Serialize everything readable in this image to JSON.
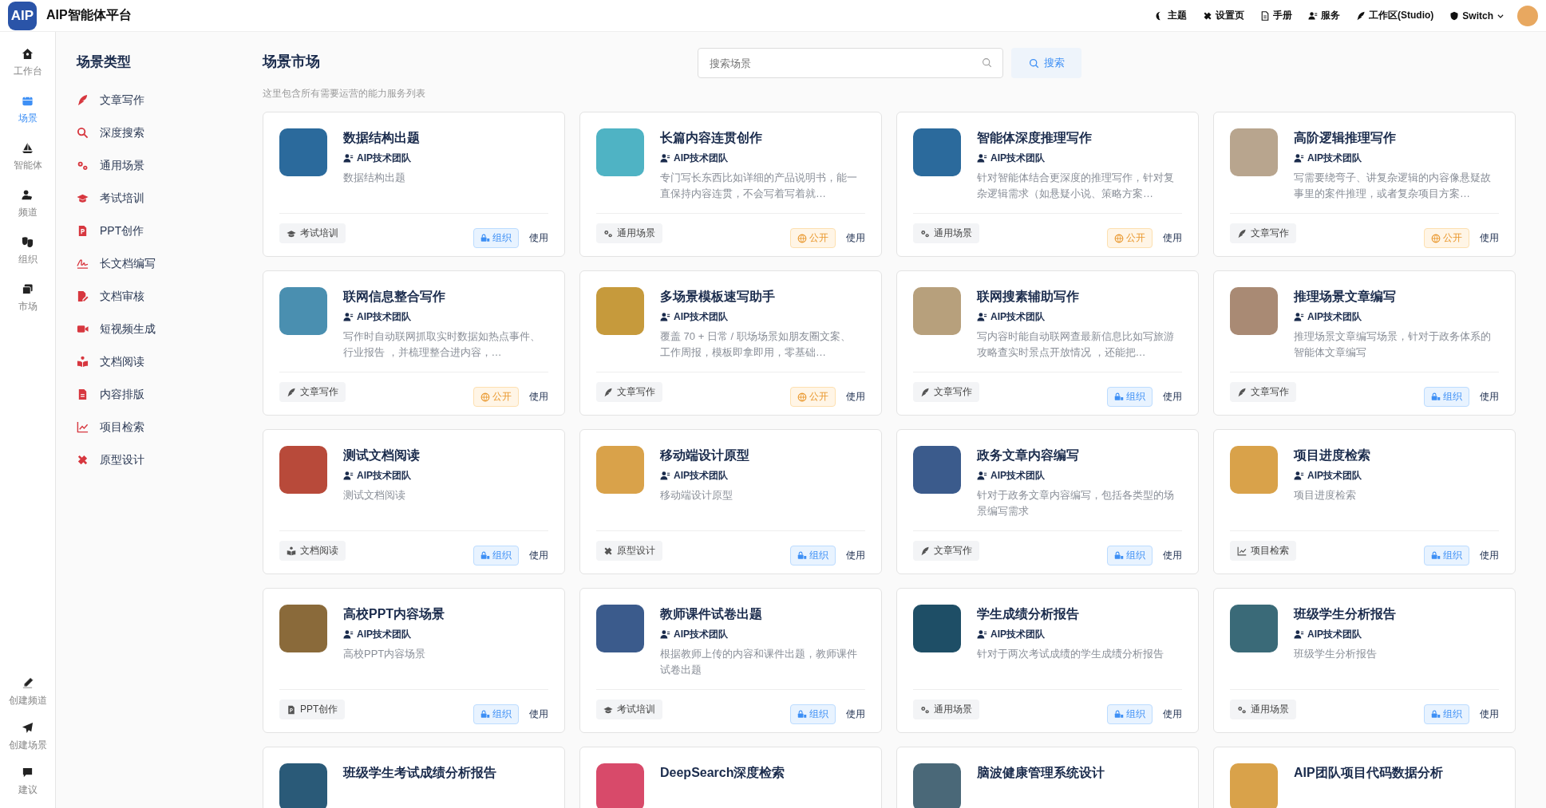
{
  "app": {
    "logo": "AIP",
    "title": "AIP智能体平台"
  },
  "top_nav": [
    {
      "kind": "theme",
      "label": "主题"
    },
    {
      "kind": "settings",
      "label": "设置页"
    },
    {
      "kind": "manual",
      "label": "手册"
    },
    {
      "kind": "service",
      "label": "服务"
    },
    {
      "kind": "studio",
      "label": "工作区(Studio)"
    },
    {
      "kind": "switch",
      "label": "Switch"
    }
  ],
  "rail": {
    "items": [
      {
        "kind": "home",
        "label": "工作台",
        "selected": false
      },
      {
        "kind": "scene",
        "label": "场景",
        "selected": true
      },
      {
        "kind": "agent",
        "label": "智能体",
        "selected": false
      },
      {
        "kind": "channel",
        "label": "频道",
        "selected": false
      },
      {
        "kind": "org",
        "label": "组织",
        "selected": false
      },
      {
        "kind": "market",
        "label": "市场",
        "selected": false
      }
    ],
    "bottom": [
      {
        "kind": "create-channel",
        "label": "创建频道"
      },
      {
        "kind": "create-scene",
        "label": "创建场景"
      },
      {
        "kind": "feedback",
        "label": "建议"
      }
    ]
  },
  "categories": {
    "title": "场景类型",
    "items": [
      {
        "kind": "writing",
        "label": "文章写作",
        "selected": false
      },
      {
        "kind": "search",
        "label": "深度搜索",
        "selected": false
      },
      {
        "kind": "general",
        "label": "通用场景",
        "selected": false
      },
      {
        "kind": "exam",
        "label": "考试培训",
        "selected": false
      },
      {
        "kind": "ppt",
        "label": "PPT创作",
        "selected": false
      },
      {
        "kind": "longdoc",
        "label": "长文档编写",
        "selected": false
      },
      {
        "kind": "review",
        "label": "文档审核",
        "selected": false
      },
      {
        "kind": "video",
        "label": "短视频生成",
        "selected": false
      },
      {
        "kind": "reading",
        "label": "文档阅读",
        "selected": false
      },
      {
        "kind": "layout",
        "label": "内容排版",
        "selected": false
      },
      {
        "kind": "chart",
        "label": "项目检索",
        "selected": false
      },
      {
        "kind": "design",
        "label": "原型设计",
        "selected": false
      }
    ]
  },
  "market": {
    "title": "场景市场",
    "subtitle": "这里包含所有需要运营的能力服务列表",
    "search": {
      "placeholder": "搜索场景",
      "button": "搜索"
    },
    "cards": [
      {
        "title": "数据结构出题",
        "team": "AIP技术团队",
        "description": "数据结构出题",
        "tag": {
          "kind": "exam",
          "label": "考试培训"
        },
        "visibility": {
          "kind": "org",
          "label": "组织"
        },
        "action": "使用"
      },
      {
        "title": "长篇内容连贯创作",
        "team": "AIP技术团队",
        "description": "专门写长东西比如详细的产品说明书，能一直保持内容连贯，不会写着写着就…",
        "tag": {
          "kind": "general",
          "label": "通用场景"
        },
        "visibility": {
          "kind": "public",
          "label": "公开"
        },
        "action": "使用"
      },
      {
        "title": "智能体深度推理写作",
        "team": "AIP技术团队",
        "description": "针对智能体结合更深度的推理写作，针对复杂逻辑需求（如悬疑小说、策略方案…",
        "tag": {
          "kind": "general",
          "label": "通用场景"
        },
        "visibility": {
          "kind": "public",
          "label": "公开"
        },
        "action": "使用"
      },
      {
        "title": "高阶逻辑推理写作",
        "team": "AIP技术团队",
        "description": "写需要绕弯子、讲复杂逻辑的内容像悬疑故事里的案件推理，或者复杂项目方案…",
        "tag": {
          "kind": "writing",
          "label": "文章写作"
        },
        "visibility": {
          "kind": "public",
          "label": "公开"
        },
        "action": "使用"
      },
      {
        "title": "联网信息整合写作",
        "team": "AIP技术团队",
        "description": "写作时自动联网抓取实时数据如热点事件、行业报告 ，并梳理整合进内容，…",
        "tag": {
          "kind": "writing",
          "label": "文章写作"
        },
        "visibility": {
          "kind": "public",
          "label": "公开"
        },
        "action": "使用"
      },
      {
        "title": "多场景模板速写助手",
        "team": "AIP技术团队",
        "description": "覆盖 70 + 日常 / 职场场景如朋友圈文案、工作周报，模板即拿即用，零基础…",
        "tag": {
          "kind": "writing",
          "label": "文章写作"
        },
        "visibility": {
          "kind": "public",
          "label": "公开"
        },
        "action": "使用"
      },
      {
        "title": "联网搜素辅助写作",
        "team": "AIP技术团队",
        "description": "写内容时能自动联网查最新信息比如写旅游攻略查实时景点开放情况 ，还能把…",
        "tag": {
          "kind": "writing",
          "label": "文章写作"
        },
        "visibility": {
          "kind": "org",
          "label": "组织"
        },
        "action": "使用"
      },
      {
        "title": "推理场景文章编写",
        "team": "AIP技术团队",
        "description": "推理场景文章编写场景，针对于政务体系的智能体文章编写",
        "tag": {
          "kind": "writing",
          "label": "文章写作"
        },
        "visibility": {
          "kind": "org",
          "label": "组织"
        },
        "action": "使用"
      },
      {
        "title": "测试文档阅读",
        "team": "AIP技术团队",
        "description": "测试文档阅读",
        "tag": {
          "kind": "reading",
          "label": "文档阅读"
        },
        "visibility": {
          "kind": "org",
          "label": "组织"
        },
        "action": "使用"
      },
      {
        "title": "移动端设计原型",
        "team": "AIP技术团队",
        "description": "移动端设计原型",
        "tag": {
          "kind": "design",
          "label": "原型设计"
        },
        "visibility": {
          "kind": "org",
          "label": "组织"
        },
        "action": "使用"
      },
      {
        "title": "政务文章内容编写",
        "team": "AIP技术团队",
        "description": "针对于政务文章内容编写，包括各类型的场景编写需求",
        "tag": {
          "kind": "writing",
          "label": "文章写作"
        },
        "visibility": {
          "kind": "org",
          "label": "组织"
        },
        "action": "使用"
      },
      {
        "title": "项目进度检索",
        "team": "AIP技术团队",
        "description": "项目进度检索",
        "tag": {
          "kind": "chart",
          "label": "项目检索"
        },
        "visibility": {
          "kind": "org",
          "label": "组织"
        },
        "action": "使用"
      },
      {
        "title": "高校PPT内容场景",
        "team": "AIP技术团队",
        "description": "高校PPT内容场景",
        "tag": {
          "kind": "ppt",
          "label": "PPT创作"
        },
        "visibility": {
          "kind": "org",
          "label": "组织"
        },
        "action": "使用"
      },
      {
        "title": "教师课件试卷出题",
        "team": "AIP技术团队",
        "description": "根据教师上传的内容和课件出题，教师课件试卷出题",
        "tag": {
          "kind": "exam",
          "label": "考试培训"
        },
        "visibility": {
          "kind": "org",
          "label": "组织"
        },
        "action": "使用"
      },
      {
        "title": "学生成绩分析报告",
        "team": "AIP技术团队",
        "description": "针对于两次考试成绩的学生成绩分析报告",
        "tag": {
          "kind": "general",
          "label": "通用场景"
        },
        "visibility": {
          "kind": "org",
          "label": "组织"
        },
        "action": "使用"
      },
      {
        "title": "班级学生分析报告",
        "team": "AIP技术团队",
        "description": "班级学生分析报告",
        "tag": {
          "kind": "general",
          "label": "通用场景"
        },
        "visibility": {
          "kind": "org",
          "label": "组织"
        },
        "action": "使用"
      },
      {
        "title": "班级学生考试成绩分析报告"
      },
      {
        "title": "DeepSearch深度检索"
      },
      {
        "title": "脑波健康管理系统设计"
      },
      {
        "title": "AIP团队项目代码数据分析"
      }
    ]
  }
}
